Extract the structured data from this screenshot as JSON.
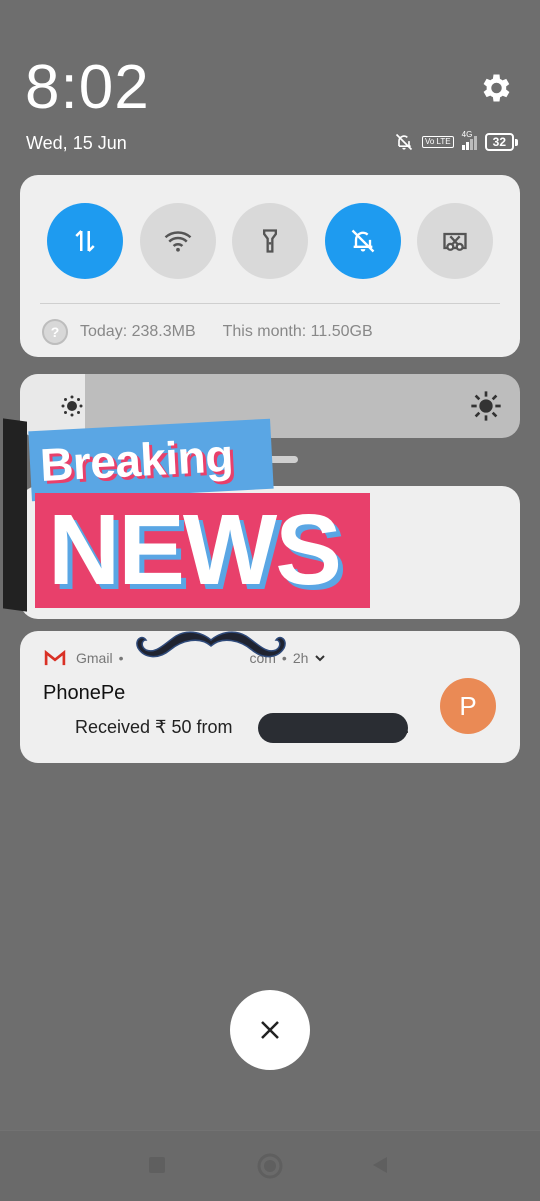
{
  "status_bar": {
    "time": "8:02",
    "date": "Wed, 15 Jun",
    "network": "4G",
    "volte": "Vo LTE",
    "battery": "32"
  },
  "quick_settings": {
    "toggles": [
      {
        "name": "mobile-data",
        "icon": "data-arrows-icon",
        "on": true
      },
      {
        "name": "wifi",
        "icon": "wifi-icon",
        "on": false
      },
      {
        "name": "flashlight",
        "icon": "flashlight-icon",
        "on": false
      },
      {
        "name": "silent",
        "icon": "bell-off-icon",
        "on": true
      },
      {
        "name": "screenshot",
        "icon": "screenshot-icon",
        "on": false
      }
    ],
    "help_glyph": "?",
    "data_today": "Today: 238.3MB",
    "data_month": "This month: 11.50GB"
  },
  "brightness": {
    "level": 0.13
  },
  "sticker": {
    "line1": "Breaking",
    "line2": "NEWS"
  },
  "notification": {
    "app": "Gmail",
    "separator": "•",
    "account_suffix": "com",
    "time": "2h",
    "title": "PhonePe",
    "body": "Received ₹ 50 from",
    "body_end": ".",
    "avatar_letter": "P"
  },
  "colors": {
    "accent": "#1e9bf0",
    "avatar": "#ea8a55",
    "sticker_pink": "#e8406b",
    "sticker_blue": "#5aa6e4"
  }
}
